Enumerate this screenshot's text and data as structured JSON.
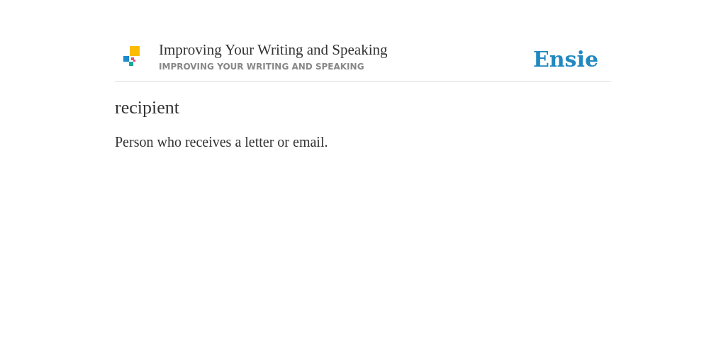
{
  "header": {
    "title": "Improving Your Writing and Speaking",
    "subtitle": "IMPROVING YOUR WRITING AND SPEAKING",
    "brand": "Ensie"
  },
  "entry": {
    "term": "recipient",
    "definition": "Person who receives a letter or email."
  }
}
